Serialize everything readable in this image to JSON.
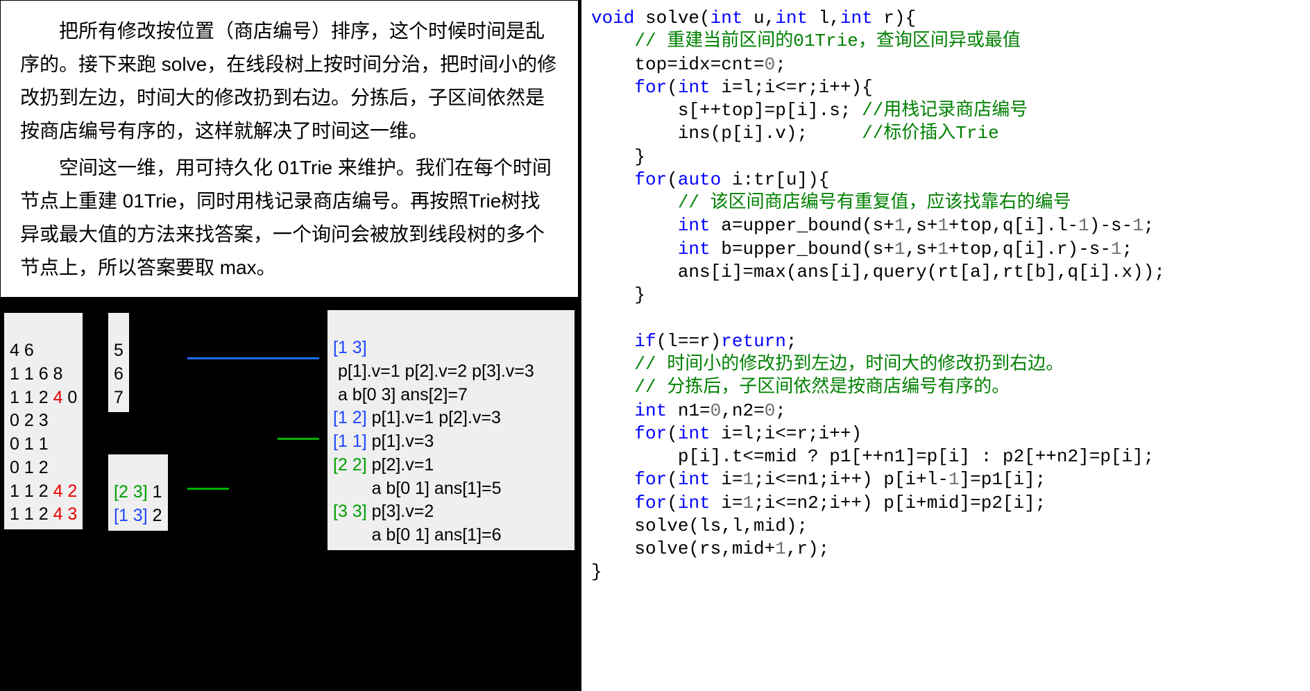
{
  "prose": {
    "p1": "把所有修改按位置（商店编号）排序，这个时候时间是乱序的。接下来跑 solve，在线段树上按时间分治，把时间小的修改扔到左边，时间大的修改扔到右边。分拣后，子区间依然是按商店编号有序的，这样就解决了时间这一维。",
    "p2": "空间这一维，用可持久化 01Trie 来维护。我们在每个时间节点上重建 01Trie，同时用栈记录商店编号。再按照Trie树找异或最大值的方法来找答案，一个询问会被放到线段树的多个节点上，所以答案要取 max。"
  },
  "box1": {
    "l1": "4 6",
    "l2": "1 1 6 8",
    "l3a": "1 1 2 ",
    "l3b": "4",
    "l3c": " 0",
    "l4": "0 2 3",
    "l5": "0 1 1",
    "l6": "0 1 2",
    "l7a": "1 1 2 ",
    "l7b": "4 2",
    "l8a": "1 1 2 ",
    "l8b": "4 3"
  },
  "box2": {
    "l1": "5",
    "l2": "6",
    "l3": "7"
  },
  "box3": {
    "l1a": "[2 3]",
    "l1b": " 1",
    "l2a": "[1 3]",
    "l2b": " 2"
  },
  "box4": {
    "l1": "[1 3]",
    "l2": " p[1].v=1 p[2].v=2 p[3].v=3",
    "l3": " a b[0 3] ans[2]=7",
    "l4a": "[1 2]",
    "l4b": " p[1].v=1 p[2].v=3",
    "l5a": "[1 1]",
    "l5b": " p[1].v=3",
    "l6a": "[2 2]",
    "l6b": " p[2].v=1",
    "l7": "        a b[0 1] ans[1]=5",
    "l8a": "[3 3]",
    "l8b": " p[3].v=2",
    "l9": "        a b[0 1] ans[1]=6"
  },
  "code": {
    "c01a": "void",
    "c01b": " solve(",
    "c01c": "int",
    "c01d": " u,",
    "c01e": "int",
    "c01f": " l,",
    "c01g": "int",
    "c01h": " r){",
    "c02": "    // 重建当前区间的01Trie，查询区间异或最值",
    "c03a": "    top=idx=cnt=",
    "c03b": "0",
    "c03c": ";",
    "c04a": "    ",
    "c04b": "for",
    "c04c": "(",
    "c04d": "int",
    "c04e": " i=l;i<=r;i++){",
    "c05a": "        s[++top]=p[i].s; ",
    "c05b": "//用栈记录商店编号",
    "c06a": "        ins(p[i].v);     ",
    "c06b": "//标价插入Trie",
    "c07": "    }",
    "c08a": "    ",
    "c08b": "for",
    "c08c": "(",
    "c08d": "auto",
    "c08e": " i:tr[u]){",
    "c09": "        // 该区间商店编号有重复值，应该找靠右的编号",
    "c10a": "        ",
    "c10b": "int",
    "c10c": " a=upper_bound(s+",
    "c10d": "1",
    "c10e": ",s+",
    "c10f": "1",
    "c10g": "+top,q[i].l-",
    "c10h": "1",
    "c10i": ")-s-",
    "c10j": "1",
    "c10k": ";",
    "c11a": "        ",
    "c11b": "int",
    "c11c": " b=upper_bound(s+",
    "c11d": "1",
    "c11e": ",s+",
    "c11f": "1",
    "c11g": "+top,q[i].r)-s-",
    "c11h": "1",
    "c11i": ";",
    "c12": "        ans[i]=max(ans[i],query(rt[a],rt[b],q[i].x));",
    "c13": "    }",
    "c14": "",
    "c15a": "    ",
    "c15b": "if",
    "c15c": "(l==r)",
    "c15d": "return",
    "c15e": ";",
    "c16": "    // 时间小的修改扔到左边，时间大的修改扔到右边。",
    "c17": "    // 分拣后，子区间依然是按商店编号有序的。",
    "c18a": "    ",
    "c18b": "int",
    "c18c": " n1=",
    "c18d": "0",
    "c18e": ",n2=",
    "c18f": "0",
    "c18g": ";",
    "c19a": "    ",
    "c19b": "for",
    "c19c": "(",
    "c19d": "int",
    "c19e": " i=l;i<=r;i++)",
    "c20": "        p[i].t<=mid ? p1[++n1]=p[i] : p2[++n2]=p[i];",
    "c21a": "    ",
    "c21b": "for",
    "c21c": "(",
    "c21d": "int",
    "c21e": " i=",
    "c21f": "1",
    "c21g": ";i<=n1;i++) p[i+l-",
    "c21h": "1",
    "c21i": "]=p1[i];",
    "c22a": "    ",
    "c22b": "for",
    "c22c": "(",
    "c22d": "int",
    "c22e": " i=",
    "c22f": "1",
    "c22g": ";i<=n2;i++) p[i+mid]=p2[i];",
    "c23": "    solve(ls,l,mid);",
    "c24a": "    solve(rs,mid+",
    "c24b": "1",
    "c24c": ",r);",
    "c25": "}"
  }
}
